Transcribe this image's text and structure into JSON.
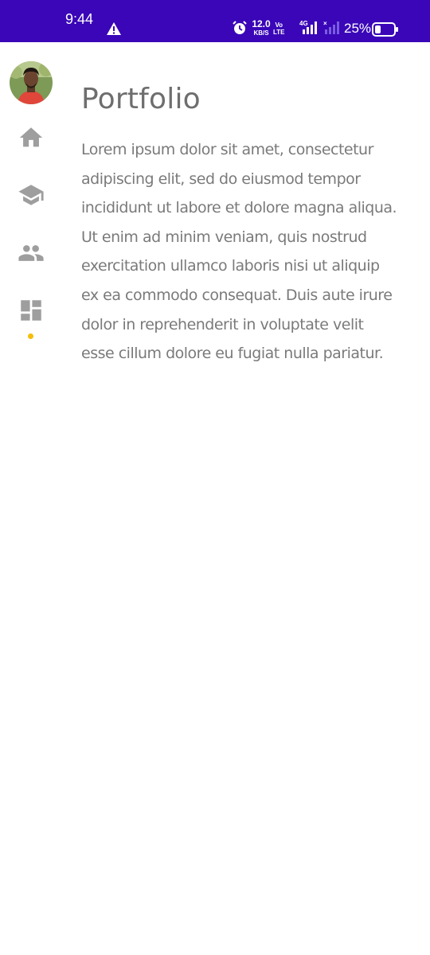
{
  "status_bar": {
    "time": "9:44",
    "speed_value": "12.0",
    "speed_unit": "KB/S",
    "volte_top": "Vo",
    "volte_bottom": "LTE",
    "network_label": "4G",
    "battery_percent": "25%",
    "background_color": "#3a06b8"
  },
  "sidebar": {
    "items": [
      {
        "icon": "home-icon",
        "label": "Home"
      },
      {
        "icon": "school-icon",
        "label": "Education"
      },
      {
        "icon": "people-icon",
        "label": "People"
      },
      {
        "icon": "dashboard-icon",
        "label": "Portfolio",
        "active": true
      }
    ],
    "active_indicator_color": "#f5bd0a"
  },
  "main": {
    "title": "Portfolio",
    "body": "Lorem ipsum dolor sit amet, consectetur adipiscing elit, sed do eiusmod tempor incididunt ut labore et dolore magna aliqua. Ut enim ad minim veniam, quis nostrud exercitation ullamco laboris nisi ut aliquip ex ea commodo consequat. Duis aute irure dolor in reprehenderit in voluptate velit esse cillum dolore eu fugiat nulla pariatur."
  }
}
